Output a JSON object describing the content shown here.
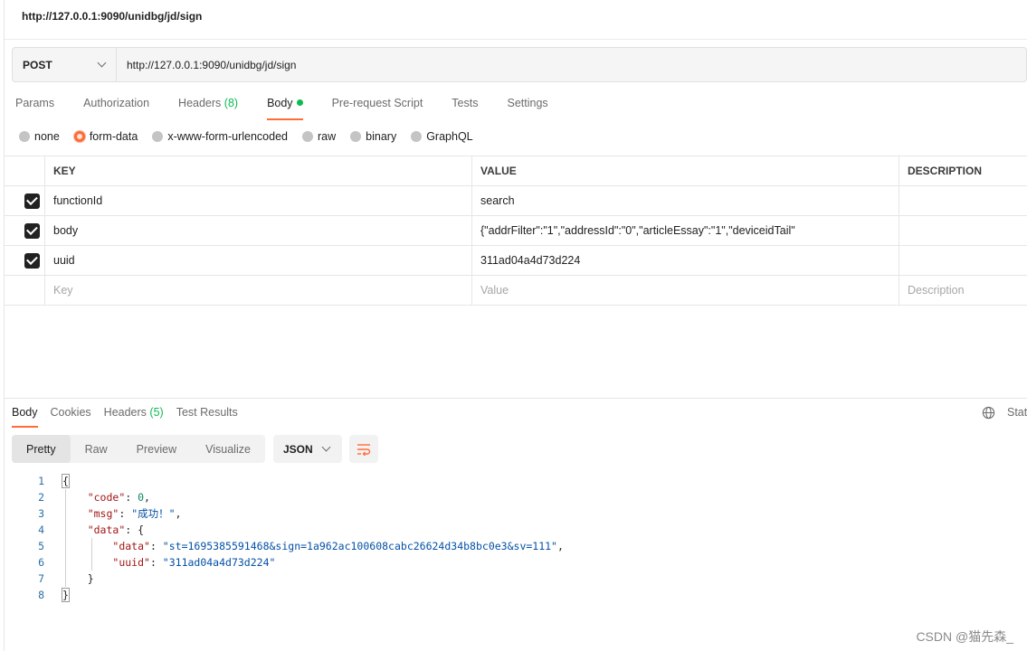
{
  "request": {
    "title": "http://127.0.0.1:9090/unidbg/jd/sign",
    "method": "POST",
    "url": "http://127.0.0.1:9090/unidbg/jd/sign"
  },
  "request_tabs": [
    {
      "label": "Params"
    },
    {
      "label": "Authorization"
    },
    {
      "label": "Headers",
      "count": "(8)"
    },
    {
      "label": "Body"
    },
    {
      "label": "Pre-request Script"
    },
    {
      "label": "Tests"
    },
    {
      "label": "Settings"
    }
  ],
  "body_types": [
    "none",
    "form-data",
    "x-www-form-urlencoded",
    "raw",
    "binary",
    "GraphQL"
  ],
  "body_type_selected": "form-data",
  "table": {
    "headers": {
      "key": "KEY",
      "value": "VALUE",
      "description": "DESCRIPTION"
    },
    "rows": [
      {
        "key": "functionId",
        "value": "search",
        "description": ""
      },
      {
        "key": "body",
        "value": "{\"addrFilter\":\"1\",\"addressId\":\"0\",\"articleEssay\":\"1\",\"deviceidTail\"",
        "description": ""
      },
      {
        "key": "uuid",
        "value": "311ad04a4d73d224",
        "description": ""
      }
    ],
    "placeholders": {
      "key": "Key",
      "value": "Value",
      "description": "Description"
    }
  },
  "response_tabs": [
    {
      "label": "Body"
    },
    {
      "label": "Cookies"
    },
    {
      "label": "Headers",
      "count": "(5)"
    },
    {
      "label": "Test Results"
    }
  ],
  "response_status_label": "Stat",
  "view_modes": [
    "Pretty",
    "Raw",
    "Preview",
    "Visualize"
  ],
  "view_mode_selected": "Pretty",
  "format": "JSON",
  "code_lines": [
    {
      "n": "1",
      "text": "{"
    },
    {
      "n": "2",
      "key": "\"code\"",
      "sep": ": ",
      "num": "0",
      "end": ","
    },
    {
      "n": "3",
      "key": "\"msg\"",
      "sep": ": ",
      "str": "\"成功！\"",
      "end": ","
    },
    {
      "n": "4",
      "key": "\"data\"",
      "sep": ": ",
      "end": "{"
    },
    {
      "n": "5",
      "key": "\"data\"",
      "sep": ": ",
      "str": "\"st=1695385591468&sign=1a962ac100608cabc26624d34b8bc0e3&sv=111\"",
      "end": ","
    },
    {
      "n": "6",
      "key": "\"uuid\"",
      "sep": ": ",
      "str": "\"311ad04a4d73d224\"",
      "end": ""
    },
    {
      "n": "7",
      "text": "}"
    },
    {
      "n": "8",
      "text": "}"
    }
  ],
  "watermark": "CSDN @猫先森_",
  "colors": {
    "accent": "#ff6c37",
    "success": "#0cbb52"
  }
}
